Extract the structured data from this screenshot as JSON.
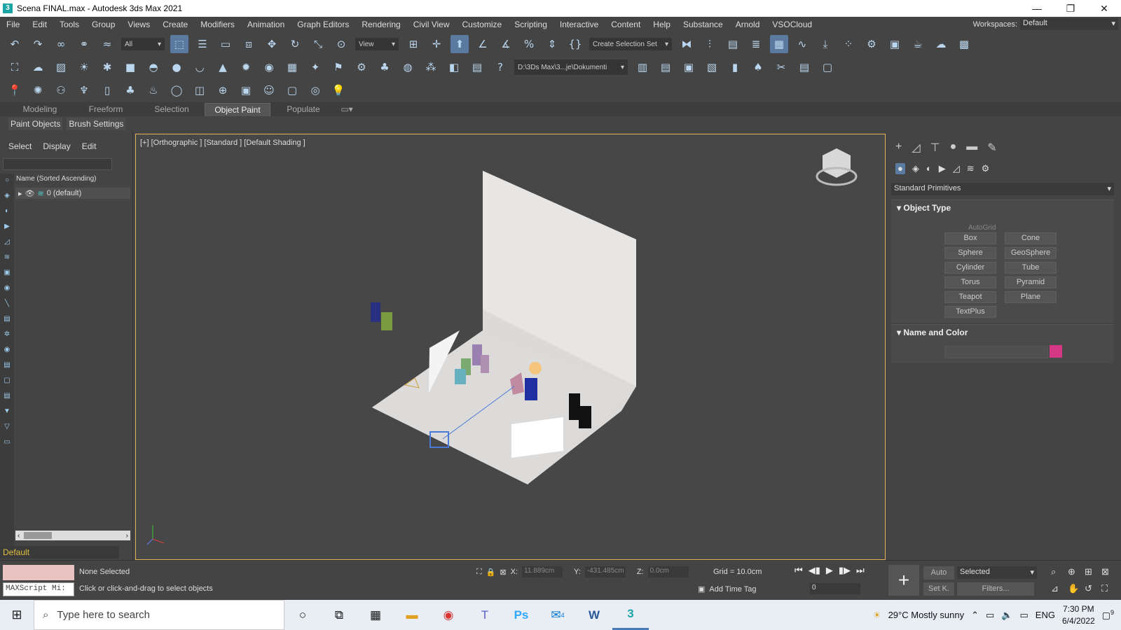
{
  "window": {
    "title": "Scena FINAL.max - Autodesk 3ds Max 2021",
    "minimize": "—",
    "restore": "❐",
    "close": "✕"
  },
  "menu": [
    "File",
    "Edit",
    "Tools",
    "Group",
    "Views",
    "Create",
    "Modifiers",
    "Animation",
    "Graph Editors",
    "Rendering",
    "Civil View",
    "Customize",
    "Scripting",
    "Interactive",
    "Content",
    "Help",
    "Substance",
    "Arnold",
    "VSOCloud"
  ],
  "workspaces": {
    "label": "Workspaces:",
    "value": "Default"
  },
  "toolbar": {
    "filter": "All",
    "ref_coord": "View",
    "selection_set": "Create Selection Set",
    "project_path": "D:\\3Ds Max\\3...je\\Dokumenti"
  },
  "ribbon": {
    "tabs": [
      "Modeling",
      "Freeform",
      "Selection",
      "Object Paint",
      "Populate"
    ],
    "active": "Object Paint",
    "sub": [
      "Paint Objects",
      "Brush Settings"
    ]
  },
  "scene_explorer": {
    "tabs": [
      "Select",
      "Display",
      "Edit"
    ],
    "column": "Name (Sorted Ascending)",
    "layer_row": "0 (default)",
    "layer_select": "Default"
  },
  "viewport": {
    "label": "[+] [Orthographic ] [Standard ] [Default Shading ]"
  },
  "command_panel": {
    "category": "Standard Primitives",
    "object_type": "Object Type",
    "autogrid": "AutoGrid",
    "buttons": [
      "Box",
      "Cone",
      "Sphere",
      "GeoSphere",
      "Cylinder",
      "Tube",
      "Torus",
      "Pyramid",
      "Teapot",
      "Plane",
      "TextPlus"
    ],
    "name_color": "Name and Color",
    "color": "#d43784"
  },
  "status": {
    "maxscript": "MAXScript Mi:",
    "selected": "None Selected",
    "hint": "Click or click-and-drag to select objects",
    "x_label": "X:",
    "x": "11.889cm",
    "y_label": "Y:",
    "y": "-431.485cm",
    "z_label": "Z:",
    "z": "0.0cm",
    "grid": "Grid = 10.0cm",
    "time_tag": "Add Time Tag",
    "frame": "0",
    "auto": "Auto",
    "setk": "Set K.",
    "key_mode": "Selected",
    "filters": "Filters..."
  },
  "taskbar": {
    "search": "Type here to search",
    "weather": "29°C  Mostly sunny",
    "lang": "ENG",
    "time": "7:30 PM",
    "date": "6/4/2022",
    "notif": "9",
    "mail_badge": "4"
  }
}
